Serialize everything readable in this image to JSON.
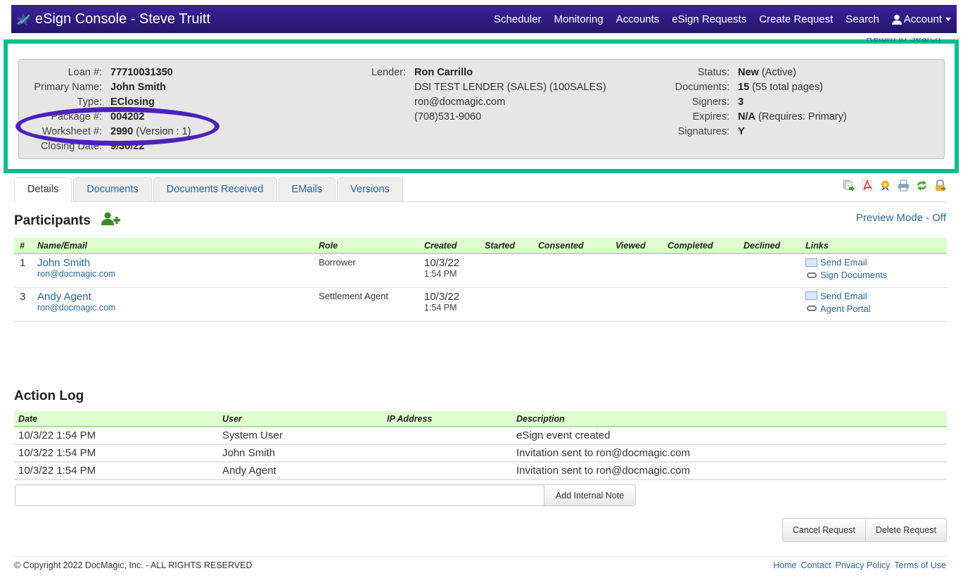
{
  "navbar": {
    "title": "eSign Console - Steve Truitt",
    "links": [
      "Scheduler",
      "Monitoring",
      "Accounts",
      "eSign Requests",
      "Create Request",
      "Search"
    ],
    "account_label": "Account"
  },
  "return_to_search": "Return to Search",
  "loan_info": {
    "left": [
      {
        "label": "Loan #:",
        "value": "77710031350",
        "extra": ""
      },
      {
        "label": "Primary Name:",
        "value": "John Smith",
        "extra": ""
      },
      {
        "label": "Type:",
        "value": "EClosing",
        "extra": ""
      },
      {
        "label": "Package #:",
        "value": "004202",
        "extra": ""
      },
      {
        "label": "Worksheet #:",
        "value": "2990",
        "extra": " (Version : 1)"
      },
      {
        "label": "Closing Date:",
        "value": "9/30/22",
        "extra": ""
      }
    ],
    "lender": {
      "label": "Lender:",
      "name": "Ron Carrillo",
      "company": "DSI TEST LENDER (SALES) (100SALES)",
      "email": "ron@docmagic.com",
      "phone": "(708)531-9060"
    },
    "right": [
      {
        "label": "Status:",
        "value": "New",
        "extra": " (Active)"
      },
      {
        "label": "Documents:",
        "value": "15",
        "extra": " (55 total pages)"
      },
      {
        "label": "Signers:",
        "value": "3",
        "extra": ""
      },
      {
        "label": "Expires:",
        "value": "N/A",
        "extra": " (Requires: Primary)"
      },
      {
        "label": "Signatures:",
        "value": "Y",
        "extra": ""
      }
    ]
  },
  "tabs": [
    "Details",
    "Documents",
    "Documents Received",
    "EMails",
    "Versions"
  ],
  "active_tab": "Details",
  "toolbar_icons": [
    "export-documents-icon",
    "pdf-icon",
    "certificate-icon",
    "print-icon",
    "refresh-icon",
    "unlock-icon"
  ],
  "participants": {
    "title": "Participants",
    "preview_mode": "Preview Mode - Off",
    "columns": [
      "#",
      "Name/Email",
      "Role",
      "Created",
      "Started",
      "Consented",
      "Viewed",
      "Completed",
      "Declined",
      "Links"
    ],
    "rows": [
      {
        "num": "1",
        "name": "John Smith",
        "email": "ron@docmagic.com",
        "role": "Borrower",
        "created_date": "10/3/22",
        "created_time": "1:54 PM",
        "started": "",
        "consented": "",
        "viewed": "",
        "completed": "",
        "declined": "",
        "link1": "Send Email",
        "link2": "Sign Documents"
      },
      {
        "num": "3",
        "name": "Andy Agent",
        "email": "ron@docmagic.com",
        "role": "Settlement Agent",
        "created_date": "10/3/22",
        "created_time": "1:54 PM",
        "started": "",
        "consented": "",
        "viewed": "",
        "completed": "",
        "declined": "",
        "link1": "Send Email",
        "link2": "Agent Portal"
      }
    ]
  },
  "action_log": {
    "title": "Action Log",
    "columns": [
      "Date",
      "User",
      "IP Address",
      "Description"
    ],
    "rows": [
      {
        "date": "10/3/22 1:54 PM",
        "user": "System User",
        "ip": "",
        "description": "eSign event created"
      },
      {
        "date": "10/3/22 1:54 PM",
        "user": "John Smith",
        "ip": "",
        "description": "Invitation sent to ron@docmagic.com"
      },
      {
        "date": "10/3/22 1:54 PM",
        "user": "Andy Agent",
        "ip": "",
        "description": "Invitation sent to ron@docmagic.com"
      }
    ],
    "note_value": "",
    "add_note_label": "Add Internal Note"
  },
  "buttons": {
    "cancel": "Cancel Request",
    "delete": "Delete Request"
  },
  "footer": {
    "copyright": "© Copyright 2022 DocMagic, Inc. - ALL RIGHTS RESERVED",
    "links": [
      "Home",
      "Contact",
      "Privacy Policy",
      "Terms of Use"
    ]
  },
  "colors": {
    "navbar": "#2f1d85",
    "highlight_frame": "#00c08b",
    "annotation_ellipse": "#4b22b8",
    "table_header": "#dfffd0",
    "link": "#2a6496"
  }
}
